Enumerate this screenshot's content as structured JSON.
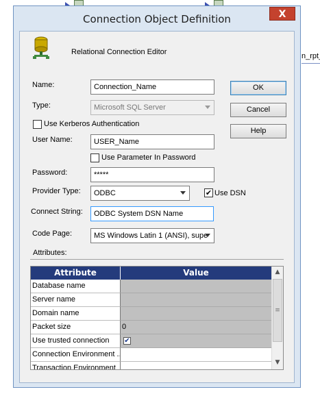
{
  "background": {
    "fragment_text": "n_rpt_"
  },
  "dialog": {
    "title": "Connection Object Definition",
    "close_glyph": "X",
    "header_label": "Relational Connection Editor"
  },
  "labels": {
    "name": "Name:",
    "type": "Type:",
    "use_kerberos": "Use Kerberos Authentication",
    "user_name": "User Name:",
    "use_parameter": "Use Parameter In Password",
    "password": "Password:",
    "provider_type": "Provider Type:",
    "use_dsn": "Use DSN",
    "connect_string": "Connect String:",
    "code_page": "Code Page:",
    "attributes": "Attributes:"
  },
  "fields": {
    "name": "Connection_Name",
    "type": "Microsoft SQL Server",
    "user_name": "USER_Name",
    "password": "*****",
    "provider_type": "ODBC",
    "connect_string": "ODBC System DSN Name",
    "code_page": "MS Windows Latin 1 (ANSI), supe"
  },
  "checkboxes": {
    "use_kerberos": false,
    "use_parameter": false,
    "use_dsn": true,
    "check_glyph": "✔"
  },
  "buttons": {
    "ok": "OK",
    "cancel": "Cancel",
    "help": "Help"
  },
  "grid": {
    "headers": [
      "Attribute",
      "Value"
    ],
    "rows": [
      {
        "attribute": "Database name",
        "value": ""
      },
      {
        "attribute": "Server name",
        "value": ""
      },
      {
        "attribute": "Domain name",
        "value": ""
      },
      {
        "attribute": "Packet size",
        "value": "0"
      },
      {
        "attribute": "Use trusted connection",
        "value": "✔"
      },
      {
        "attribute": "Connection Environment ...",
        "value": ""
      },
      {
        "attribute": "Transaction Environment",
        "value": ""
      }
    ]
  },
  "colors": {
    "grid_header": "#243b7c",
    "close_button": "#c4422e",
    "dialog_border": "#6f93c2"
  }
}
